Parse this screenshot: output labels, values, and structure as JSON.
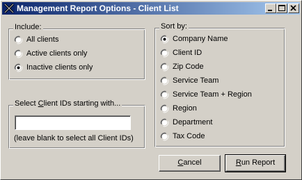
{
  "window": {
    "title": "Management Report Options - Client List"
  },
  "include": {
    "legend": "Include:",
    "options": [
      "All clients",
      "Active clients only",
      "Inactive clients only"
    ],
    "selected_index": 2
  },
  "client_ids": {
    "legend_pre": "Select ",
    "legend_accel": "C",
    "legend_post": "lient IDs starting with...",
    "value": "",
    "hint": "(leave blank to select all Client IDs)"
  },
  "sort_by": {
    "legend": "Sort by:",
    "options": [
      "Company Name",
      "Client ID",
      "Zip Code",
      "Service Team",
      "Service Team + Region",
      "Region",
      "Department",
      "Tax Code"
    ],
    "selected_index": 0
  },
  "buttons": {
    "cancel_accel": "C",
    "cancel_rest": "ancel",
    "run_accel": "R",
    "run_rest": "un Report"
  }
}
